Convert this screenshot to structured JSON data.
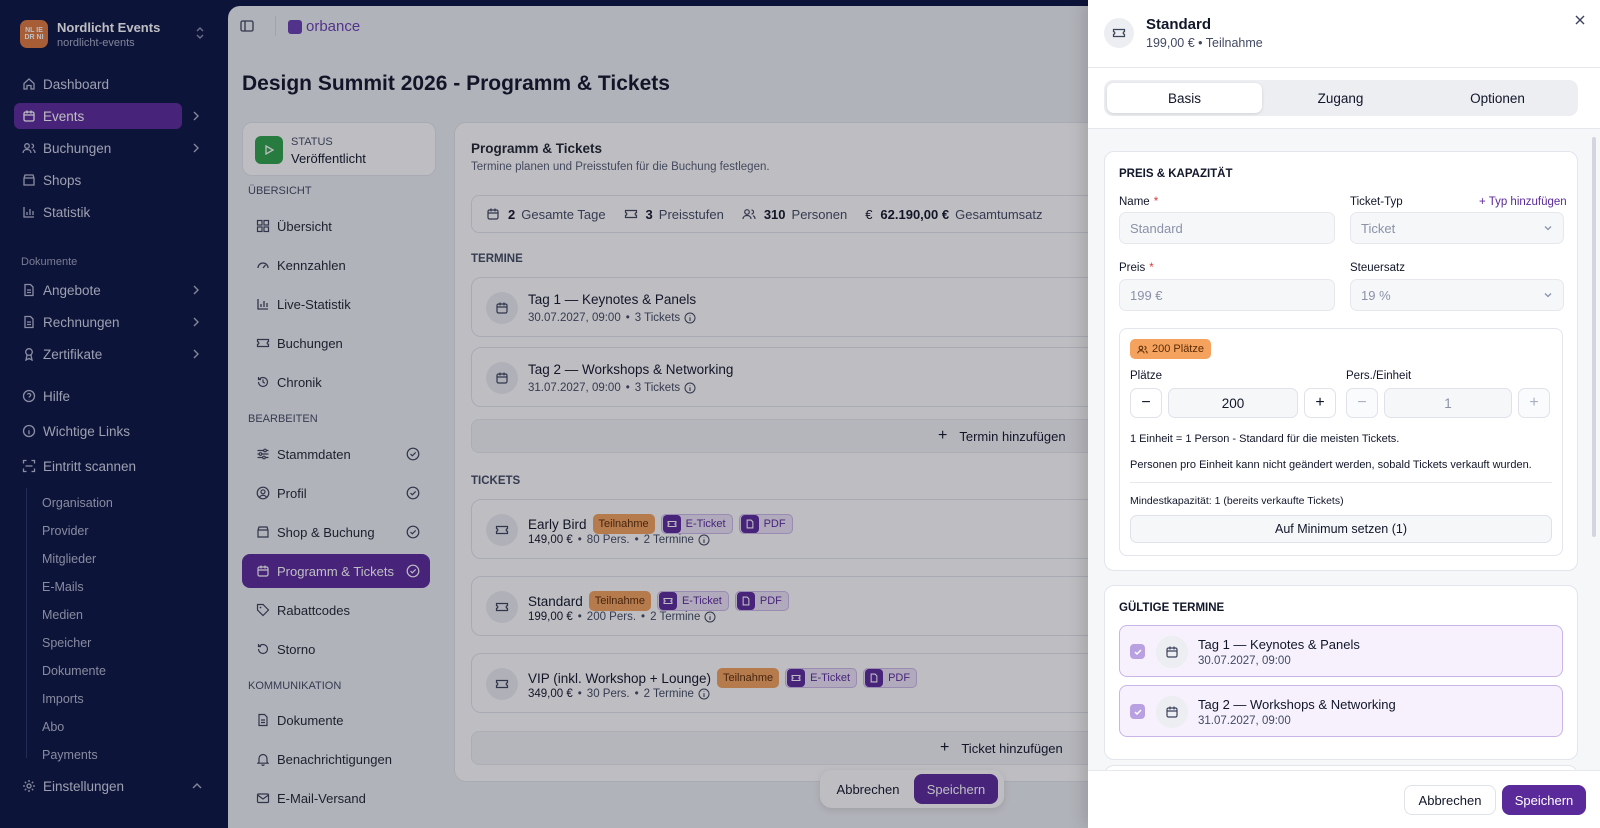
{
  "org": {
    "name": "Nordlicht Events",
    "slug": "nordlicht-events",
    "logo_text": "NLIE\nDRNI"
  },
  "sidebar": {
    "items": [
      {
        "label": "Dashboard",
        "icon": "home-icon"
      },
      {
        "label": "Events",
        "icon": "calendar-icon"
      },
      {
        "label": "Buchungen",
        "icon": "users-icon"
      },
      {
        "label": "Shops",
        "icon": "store-icon"
      },
      {
        "label": "Statistik",
        "icon": "chart-icon"
      }
    ],
    "section_docs": "Dokumente",
    "doc_items": [
      {
        "label": "Angebote",
        "icon": "file-icon"
      },
      {
        "label": "Rechnungen",
        "icon": "file-icon"
      },
      {
        "label": "Zertifikate",
        "icon": "award-icon"
      }
    ],
    "help_items": [
      {
        "label": "Hilfe",
        "icon": "help-icon"
      },
      {
        "label": "Wichtige Links",
        "icon": "info-icon"
      },
      {
        "label": "Eintritt scannen",
        "icon": "scan-icon"
      }
    ],
    "sub_items": [
      "Organisation",
      "Provider",
      "Mitglieder",
      "E-Mails",
      "Medien",
      "Speicher",
      "Dokumente",
      "Imports",
      "Abo",
      "Payments"
    ],
    "settings": "Einstellungen"
  },
  "topbar": {
    "brand": "orbance"
  },
  "page": {
    "title": "Design Summit 2026 - Programm & Tickets"
  },
  "status": {
    "label": "STATUS",
    "value": "Veröffentlicht"
  },
  "left_nav": {
    "overview_label": "ÜBERSICHT",
    "overview": [
      "Übersicht",
      "Kennzahlen",
      "Live-Statistik",
      "Buchungen",
      "Chronik"
    ],
    "edit_label": "BEARBEITEN",
    "edit": [
      "Stammdaten",
      "Profil",
      "Shop & Buchung",
      "Programm & Tickets",
      "Rabattcodes",
      "Storno"
    ],
    "comm_label": "KOMMUNIKATION",
    "comm": [
      "Dokumente",
      "Benachrichtigungen",
      "E-Mail-Versand"
    ]
  },
  "content": {
    "title": "Programm & Tickets",
    "subtitle": "Termine planen und Preisstufen für die Buchung festlegen.",
    "stats": [
      {
        "value": "2",
        "label": "Gesamte Tage"
      },
      {
        "value": "3",
        "label": "Preisstufen"
      },
      {
        "value": "310",
        "label": "Personen"
      },
      {
        "value": "62.190,00 €",
        "label": "Gesamtumsatz"
      }
    ],
    "termine_label": "TERMINE",
    "termine": [
      {
        "title": "Tag 1 — Keynotes & Panels",
        "date": "30.07.2027, 09:00",
        "tickets": "3 Tickets"
      },
      {
        "title": "Tag 2 — Workshops & Networking",
        "date": "31.07.2027, 09:00",
        "tickets": "3 Tickets"
      }
    ],
    "add_termin": "Termin hinzufügen",
    "tickets_label": "TICKETS",
    "tickets": [
      {
        "name": "Early Bird",
        "type": "Teilnahme",
        "price": "149,00 €",
        "pers": "80 Pers.",
        "termine": "2 Termine"
      },
      {
        "name": "Standard",
        "type": "Teilnahme",
        "price": "199,00 €",
        "pers": "200 Pers.",
        "termine": "2 Termine"
      },
      {
        "name": "VIP (inkl. Workshop + Lounge)",
        "type": "Teilnahme",
        "price": "349,00 €",
        "pers": "30 Pers.",
        "termine": "2 Termine"
      }
    ],
    "chip_eticket": "E-Ticket",
    "chip_pdf": "PDF",
    "add_ticket": "Ticket hinzufügen",
    "cancel": "Abbrechen",
    "save": "Speichern"
  },
  "panel": {
    "title": "Standard",
    "subtitle": "199,00 € • Teilnahme",
    "tabs": [
      "Basis",
      "Zugang",
      "Optionen"
    ],
    "price_section": "PREIS & KAPAZITÄT",
    "name_label": "Name",
    "name_placeholder": "Standard",
    "ticket_type_label": "Ticket-Typ",
    "add_type": "+ Typ hinzufügen",
    "ticket_type_value": "Ticket",
    "price_label": "Preis",
    "price_placeholder": "199 €",
    "tax_label": "Steuersatz",
    "tax_value": "19 %",
    "capacity_badge": "200 Plätze",
    "places_label": "Plätze",
    "places_value": "200",
    "pers_label": "Pers./Einheit",
    "pers_value": "1",
    "note1": "1 Einheit = 1 Person - Standard für die meisten Tickets.",
    "note2": "Personen pro Einheit kann nicht geändert werden, sobald Tickets verkauft wurden.",
    "min_note": "Mindestkapazität: 1 (bereits verkaufte Tickets)",
    "min_button": "Auf Minimum setzen (1)",
    "valid_section": "GÜLTIGE TERMINE",
    "valid_dates": [
      {
        "title": "Tag 1 — Keynotes & Panels",
        "date": "30.07.2027, 09:00"
      },
      {
        "title": "Tag 2 — Workshops & Networking",
        "date": "31.07.2027, 09:00"
      }
    ],
    "cancel": "Abbrechen",
    "save": "Speichern"
  },
  "colors": {
    "accent": "#5b2a9a",
    "sidebar_bg": "#0b1442",
    "status_green": "#2fa34a",
    "badge_orange": "#f4a25d"
  }
}
